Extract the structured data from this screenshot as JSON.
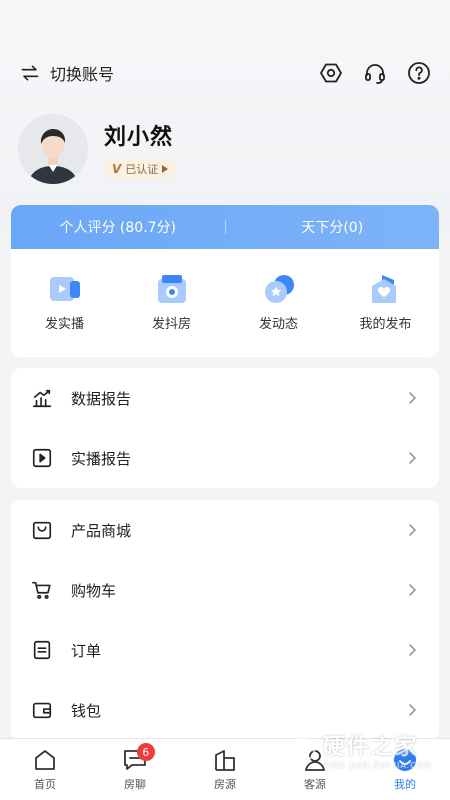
{
  "header": {
    "switch_label": "切换账号",
    "icons": [
      "settings-hexagon-icon",
      "headset-icon",
      "help-icon"
    ]
  },
  "profile": {
    "name": "刘小然",
    "verified_label": "已认证"
  },
  "score": {
    "personal": "个人评分 (80.7分)",
    "tianxia": "天下分(0)"
  },
  "actions": [
    {
      "label": "发实播"
    },
    {
      "label": "发抖房"
    },
    {
      "label": "发动态"
    },
    {
      "label": "我的发布"
    }
  ],
  "reports": [
    {
      "label": "数据报告"
    },
    {
      "label": "实播报告"
    }
  ],
  "shop": [
    {
      "label": "产品商城"
    },
    {
      "label": "购物车"
    },
    {
      "label": "订单"
    },
    {
      "label": "钱包"
    }
  ],
  "tabbar": {
    "tabs": [
      {
        "label": "首页"
      },
      {
        "label": "房聊"
      },
      {
        "label": "房源"
      },
      {
        "label": "客源"
      },
      {
        "label": "我的"
      }
    ],
    "chat_badge": "6",
    "active": "我的"
  },
  "colors": {
    "accent": "#2d7bf0",
    "score_bar": "#6aa7f7",
    "badge": "#f23b3b"
  },
  "watermark": {
    "main": "硬件之家",
    "sub": "YING JIAN ZHI JIA.COM"
  }
}
